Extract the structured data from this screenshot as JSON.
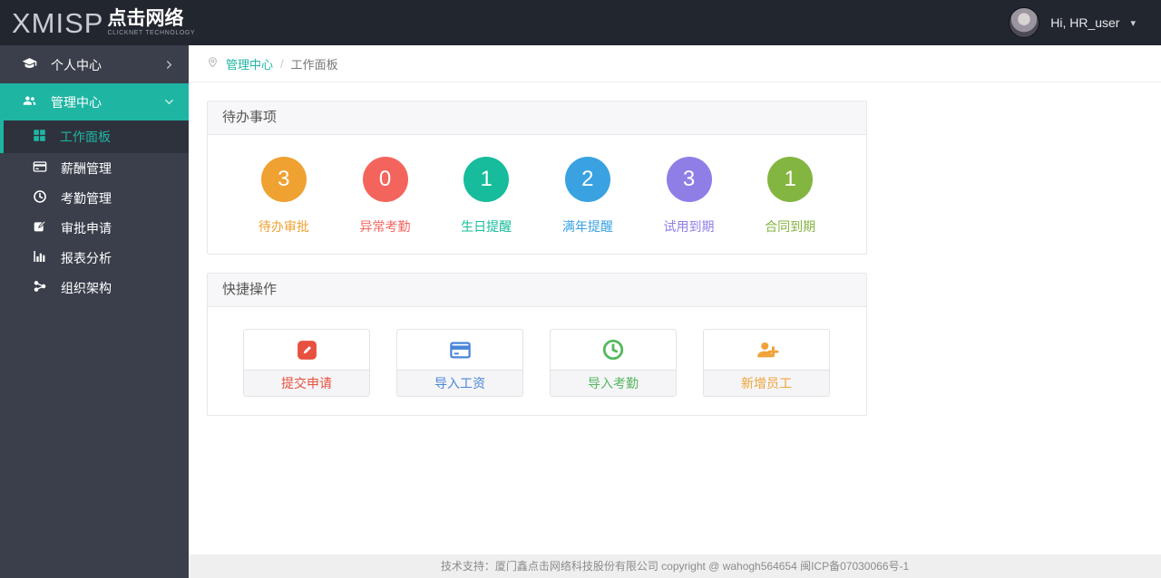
{
  "header": {
    "logo_en": "XMISP",
    "logo_cn": "点击网络",
    "logo_sub": "CLICKNET TECHNOLOGY",
    "greeting": "Hi, HR_user",
    "caret": "▾"
  },
  "sidebar": {
    "accent_color": "#1fb5a3",
    "parents": [
      {
        "label": "个人中心",
        "icon": "graduation-cap-icon",
        "state": "collapsed"
      },
      {
        "label": "管理中心",
        "icon": "users-icon",
        "state": "expanded"
      }
    ],
    "submenu": [
      {
        "label": "工作面板",
        "icon": "grid-icon",
        "selected": true
      },
      {
        "label": "薪酬管理",
        "icon": "credit-card-icon",
        "selected": false
      },
      {
        "label": "考勤管理",
        "icon": "clock-icon",
        "selected": false
      },
      {
        "label": "审批申请",
        "icon": "edit-icon",
        "selected": false
      },
      {
        "label": "报表分析",
        "icon": "bar-chart-icon",
        "selected": false
      },
      {
        "label": "组织架构",
        "icon": "org-icon",
        "selected": false
      }
    ]
  },
  "breadcrumb": {
    "root": "管理中心",
    "separator": "/",
    "current": "工作面板"
  },
  "todo_panel": {
    "title": "待办事项",
    "items": [
      {
        "count": "3",
        "label": "待办审批",
        "color": "#efa131"
      },
      {
        "count": "0",
        "label": "异常考勤",
        "color": "#f3655c"
      },
      {
        "count": "1",
        "label": "生日提醒",
        "color": "#16bc9c"
      },
      {
        "count": "2",
        "label": "满年提醒",
        "color": "#3aa2e0"
      },
      {
        "count": "3",
        "label": "试用到期",
        "color": "#8f7ee5"
      },
      {
        "count": "1",
        "label": "合同到期",
        "color": "#83b541"
      }
    ]
  },
  "quick_panel": {
    "title": "快捷操作",
    "actions": [
      {
        "label": "提交申请",
        "icon": "pencil-badge-icon",
        "color": "#e8503f"
      },
      {
        "label": "导入工资",
        "icon": "credit-card-icon",
        "color": "#4a86d8"
      },
      {
        "label": "导入考勤",
        "icon": "clock-icon",
        "color": "#55b85e"
      },
      {
        "label": "新增员工",
        "icon": "user-plus-icon",
        "color": "#f0a33a"
      }
    ]
  },
  "footer": {
    "text": "技术支持：厦门鑫点击网络科技股份有限公司  copyright @ wahogh564654  闽ICP备07030066号-1"
  }
}
